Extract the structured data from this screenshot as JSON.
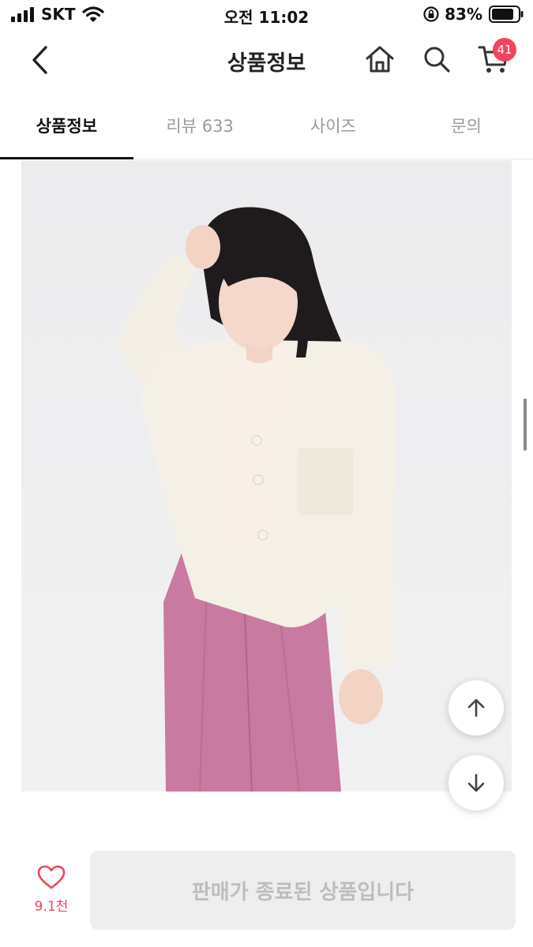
{
  "status_bar": {
    "carrier": "SKT",
    "time": "오전 11:02",
    "battery": "83%"
  },
  "header": {
    "title": "상품정보",
    "cart_count": "41"
  },
  "tabs": [
    {
      "label": "상품정보",
      "active": true
    },
    {
      "label": "리뷰 633",
      "active": false
    },
    {
      "label": "사이즈",
      "active": false
    },
    {
      "label": "문의",
      "active": false
    }
  ],
  "bottom": {
    "like_count": "9.1천",
    "cta_label": "판매가 종료된 상품입니다"
  },
  "colors": {
    "accent": "#f0455b",
    "jacket": "#f4f0e6",
    "pants": "#c9799f"
  }
}
